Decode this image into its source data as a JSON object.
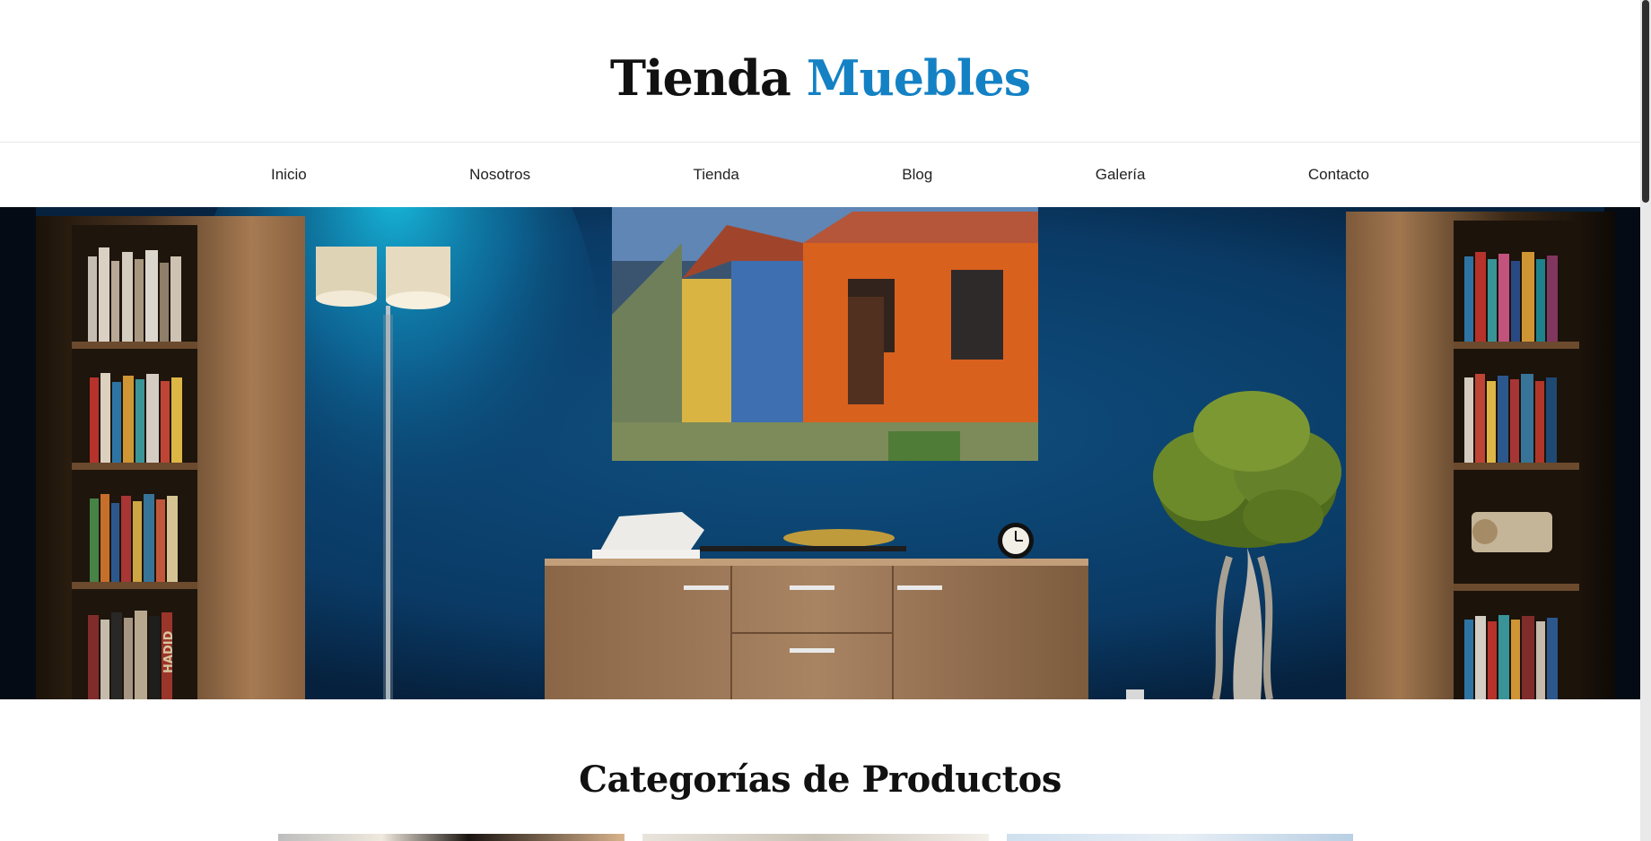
{
  "header": {
    "brand_part1": "Tienda",
    "brand_part2": "Muebles",
    "accent_color": "#1481c4"
  },
  "nav": {
    "items": [
      {
        "label": "Inicio"
      },
      {
        "label": "Nosotros"
      },
      {
        "label": "Tienda"
      },
      {
        "label": "Blog"
      },
      {
        "label": "Galería"
      },
      {
        "label": "Contacto"
      }
    ]
  },
  "hero": {
    "image": "living-room-blue-wall-with-painting-sideboard-lamp-plant-bookshelves",
    "bookshelf_text": "HADID"
  },
  "categories": {
    "title": "Categorías de Productos"
  }
}
